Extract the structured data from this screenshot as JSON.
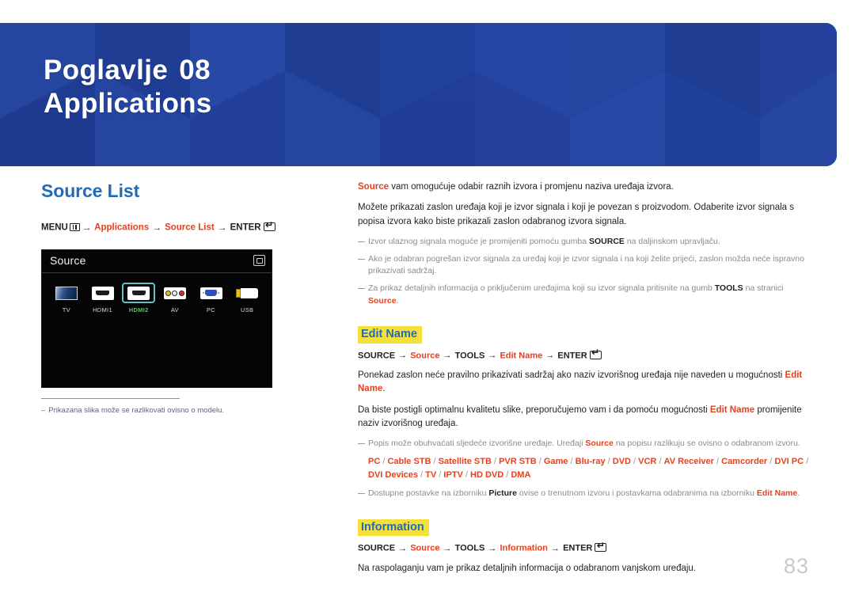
{
  "banner": {
    "chapter_label": "Poglavlje",
    "chapter_number": "08",
    "title": "Applications",
    "bg_color": "#22409a"
  },
  "left": {
    "section_title": "Source List",
    "path": {
      "menu_label": "MENU",
      "menu_icon": "menu-grid-icon",
      "arrow": "→",
      "step1": "Applications",
      "step2": "Source List",
      "enter_label": "ENTER",
      "enter_icon": "enter-key-icon"
    },
    "tv_panel": {
      "title": "Source",
      "corner_icon": "window-return-icon",
      "sources": [
        {
          "label": "TV",
          "icon": "tv-icon",
          "selected": false
        },
        {
          "label": "HDMI1",
          "icon": "hdmi-port-icon",
          "selected": false
        },
        {
          "label": "HDMI2",
          "icon": "hdmi-port-icon",
          "selected": true
        },
        {
          "label": "AV",
          "icon": "av-rca-icon",
          "selected": false
        },
        {
          "label": "PC",
          "icon": "vga-port-icon",
          "selected": false
        },
        {
          "label": "USB",
          "icon": "usb-port-icon",
          "selected": false
        }
      ],
      "selected_color": "#3fd43f",
      "highlight_color": "#5fc2c8"
    },
    "caption": {
      "dash": "–",
      "text": "Prikazana slika može se razlikovati ovisno o modelu."
    }
  },
  "right": {
    "intro": {
      "lead_term": "Source",
      "lead_rest": " vam omogućuje odabir raznih izvora i promjenu naziva uređaja izvora.",
      "paragraph": "Možete prikazati zaslon uređaja koji je izvor signala i koji je povezan s proizvodom. Odaberite izvor signala s popisa izvora kako biste prikazali zaslon odabranog izvora signala."
    },
    "notes": [
      {
        "part1": "Izvor ulaznog signala moguće je promijeniti pomoću gumba ",
        "bold1": "SOURCE",
        "part2": " na daljinskom upravljaču."
      },
      {
        "part1": "Ako je odabran pogrešan izvor signala za uređaj koji je izvor signala i na koji želite prijeći, zaslon možda neće ispravno prikazivati sadržaj."
      },
      {
        "part1": "Za prikaz detaljnih informacija o priključenim uređajima koji su izvor signala pritisnite na gumb ",
        "bold1": "TOOLS",
        "part2": " na stranici ",
        "orange1": "Source",
        "part3": "."
      }
    ],
    "edit_name": {
      "heading": "Edit Name",
      "path": {
        "source_btn": "SOURCE",
        "arrow": "→",
        "step1": "Source",
        "tools_btn": "TOOLS",
        "step2": "Edit Name",
        "enter_label": "ENTER",
        "enter_icon": "enter-key-icon"
      },
      "para1_a": "Ponekad zaslon neće pravilno prikazivati sadržaj ako naziv izvorišnog uređaja nije naveden u mogućnosti ",
      "para1_term": "Edit Name",
      "para1_b": ".",
      "para2_a": "Da biste postigli optimalnu kvalitetu slike, preporučujemo vam i da pomoću mogućnosti ",
      "para2_term": "Edit Name",
      "para2_b": " promijenite naziv izvorišnog uređaja.",
      "note_list": {
        "part1": "Popis može obuhvaćati sljedeće izvorišne uređaje. Uređaji ",
        "orange1": "Source",
        "part2": " na popisu razlikuju se ovisno o odabranom izvoru.",
        "devices": [
          "PC",
          "Cable STB",
          "Satellite STB",
          "PVR STB",
          "Game",
          "Blu-ray",
          "DVD",
          "VCR",
          "AV Receiver",
          "Camcorder",
          "DVI PC",
          "DVI Devices",
          "TV",
          "IPTV",
          "HD DVD",
          "DMA"
        ],
        "separator": "/"
      },
      "note_picture": {
        "part1": "Dostupne postavke na izborniku ",
        "bold1": "Picture",
        "part2": " ovise o trenutnom izvoru i postavkama odabranima na izborniku ",
        "orange1": "Edit Name",
        "part3": "."
      }
    },
    "information": {
      "heading": "Information",
      "path": {
        "source_btn": "SOURCE",
        "arrow": "→",
        "step1": "Source",
        "tools_btn": "TOOLS",
        "step2": "Information",
        "enter_label": "ENTER",
        "enter_icon": "enter-key-icon"
      },
      "paragraph": "Na raspolaganju vam je prikaz detaljnih informacija o odabranom vanjskom uređaju."
    }
  },
  "page_number": "83"
}
